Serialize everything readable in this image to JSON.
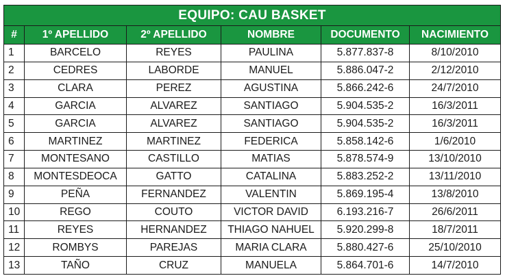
{
  "title": "EQUIPO: CAU BASKET",
  "columns": [
    "#",
    "1º APELLIDO",
    "2º APELLIDO",
    "NOMBRE",
    "DOCUMENTO",
    "NACIMIENTO"
  ],
  "rows": [
    [
      "1",
      "BARCELO",
      "REYES",
      "PAULINA",
      "5.877.837-8",
      "8/10/2010"
    ],
    [
      "2",
      "CEDRES",
      "LABORDE",
      "MANUEL",
      "5.886.047-2",
      "2/12/2010"
    ],
    [
      "3",
      "CLARA",
      "PEREZ",
      "AGUSTINA",
      "5.866.242-6",
      "24/7/2010"
    ],
    [
      "4",
      "GARCIA",
      "ALVAREZ",
      "SANTIAGO",
      "5.904.535-2",
      "16/3/2011"
    ],
    [
      "5",
      "GARCIA",
      "ALVAREZ",
      "SANTIAGO",
      "5.904.535-2",
      "16/3/2011"
    ],
    [
      "6",
      "MARTINEZ",
      "MARTINEZ",
      "FEDERICA",
      "5.858.142-6",
      "1/6/2010"
    ],
    [
      "7",
      "MONTESANO",
      "CASTILLO",
      "MATIAS",
      "5.878.574-9",
      "13/10/2010"
    ],
    [
      "8",
      "MONTESDEOCA",
      "GATTO",
      "CATALINA",
      "5.883.252-2",
      "13/11/2010"
    ],
    [
      "9",
      "PEÑA",
      "FERNANDEZ",
      "VALENTIN",
      "5.869.195-4",
      "13/8/2010"
    ],
    [
      "10",
      "REGO",
      "COUTO",
      "VICTOR DAVID",
      "6.193.216-7",
      "26/6/2011"
    ],
    [
      "11",
      "REYES",
      "HERNANDEZ",
      "THIAGO NAHUEL",
      "5.920.299-8",
      "18/7/2011"
    ],
    [
      "12",
      "ROMBYS",
      "PAREJAS",
      "MARIA CLARA",
      "5.880.427-6",
      "25/10/2010"
    ],
    [
      "13",
      "TAÑO",
      "CRUZ",
      "MANUELA",
      "5.864.701-6",
      "14/7/2010"
    ]
  ],
  "colors": {
    "header_bg": "#1a9640",
    "header_text": "#ffffff",
    "grid": "#1a1a1a",
    "cell_text": "#1a1a1a"
  }
}
